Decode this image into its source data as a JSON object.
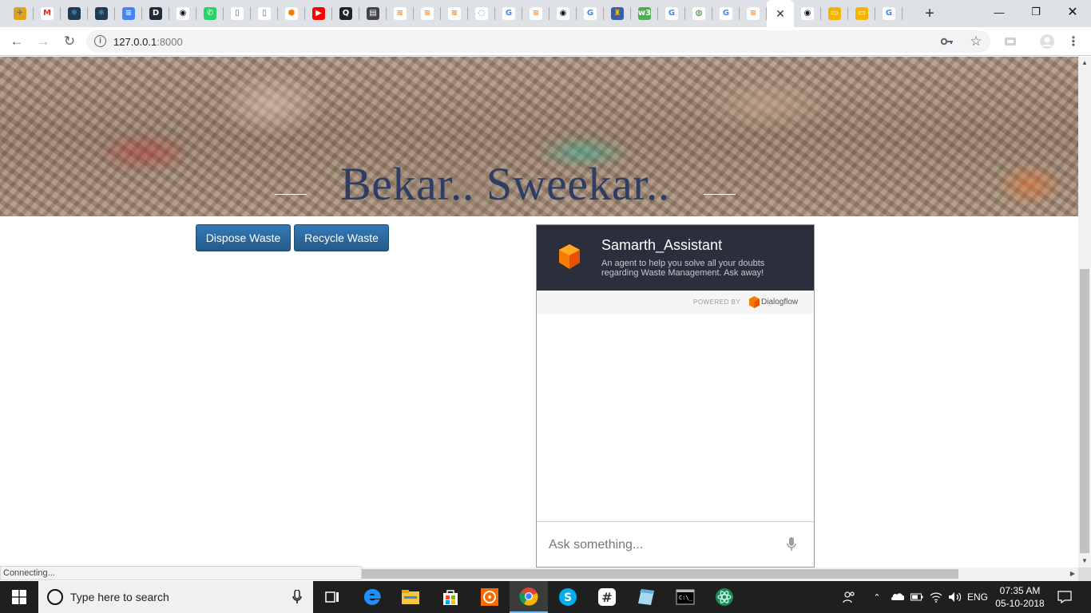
{
  "browser": {
    "tabs": [
      {
        "icon": "kite-icon",
        "glyph": "✈",
        "color": "#e0a020",
        "text_color": "#3b6fb0"
      },
      {
        "icon": "gmail-icon",
        "glyph": "M",
        "color": "#ffffff",
        "text_color": "#d93025"
      },
      {
        "icon": "react-icon",
        "glyph": "⚛",
        "color": "#1f3a52",
        "text_color": "#61dafb"
      },
      {
        "icon": "react-icon",
        "glyph": "⚛",
        "color": "#1f3a52",
        "text_color": "#61dafb"
      },
      {
        "icon": "google-docs-icon",
        "glyph": "≡",
        "color": "#4285f4",
        "text_color": "#ffffff"
      },
      {
        "icon": "dev-icon",
        "glyph": "D",
        "color": "#1d2b3a",
        "text_color": "#ffffff"
      },
      {
        "icon": "github-icon",
        "glyph": "◉",
        "color": "#ffffff",
        "text_color": "#111111"
      },
      {
        "icon": "whatsapp-icon",
        "glyph": "✆",
        "color": "#25d366",
        "text_color": "#ffffff"
      },
      {
        "icon": "document-icon",
        "glyph": "▯",
        "color": "#ffffff",
        "text_color": "#666666"
      },
      {
        "icon": "document-icon",
        "glyph": "▯",
        "color": "#ffffff",
        "text_color": "#666666"
      },
      {
        "icon": "dialogflow-icon",
        "glyph": "⬢",
        "color": "#ffffff",
        "text_color": "#f57c00"
      },
      {
        "icon": "youtube-icon",
        "glyph": "▶",
        "color": "#ff0000",
        "text_color": "#ffffff"
      },
      {
        "icon": "quora-icon",
        "glyph": "Q",
        "color": "#222222",
        "text_color": "#ffffff"
      },
      {
        "icon": "reader-icon",
        "glyph": "▤",
        "color": "#444444",
        "text_color": "#ffffff"
      },
      {
        "icon": "stackoverflow-icon",
        "glyph": "≋",
        "color": "#ffffff",
        "text_color": "#f48024"
      },
      {
        "icon": "stackoverflow-icon",
        "glyph": "≋",
        "color": "#ffffff",
        "text_color": "#f48024"
      },
      {
        "icon": "stackoverflow-icon",
        "glyph": "≋",
        "color": "#ffffff",
        "text_color": "#f48024"
      },
      {
        "icon": "loading-icon",
        "glyph": "◌",
        "color": "#ffffff",
        "text_color": "#4285f4"
      },
      {
        "icon": "google-icon",
        "glyph": "G",
        "color": "#ffffff",
        "text_color": "#4285f4"
      },
      {
        "icon": "stackoverflow-icon",
        "glyph": "≋",
        "color": "#ffffff",
        "text_color": "#f48024"
      },
      {
        "icon": "github-icon",
        "glyph": "◉",
        "color": "#ffffff",
        "text_color": "#111111"
      },
      {
        "icon": "google-icon",
        "glyph": "G",
        "color": "#ffffff",
        "text_color": "#4285f4"
      },
      {
        "icon": "lamp-icon",
        "glyph": "♜",
        "color": "#3a5fa8",
        "text_color": "#f2c200"
      },
      {
        "icon": "w3schools-icon",
        "glyph": "w3",
        "color": "#4caf50",
        "text_color": "#ffffff"
      },
      {
        "icon": "google-icon",
        "glyph": "G",
        "color": "#ffffff",
        "text_color": "#4285f4"
      },
      {
        "icon": "globe-icon",
        "glyph": "◍",
        "color": "#ffffff",
        "text_color": "#2e7d32"
      },
      {
        "icon": "google-icon",
        "glyph": "G",
        "color": "#ffffff",
        "text_color": "#4285f4"
      },
      {
        "icon": "stackoverflow-icon",
        "glyph": "≋",
        "color": "#ffffff",
        "text_color": "#f48024"
      },
      {
        "icon": "close-icon",
        "glyph": "✕",
        "active": true
      },
      {
        "icon": "github-icon",
        "glyph": "◉",
        "color": "#ffffff",
        "text_color": "#111111"
      },
      {
        "icon": "google-slides-icon",
        "glyph": "▭",
        "color": "#f4b400",
        "text_color": "#ffffff"
      },
      {
        "icon": "google-slides-icon",
        "glyph": "▭",
        "color": "#f4b400",
        "text_color": "#ffffff"
      },
      {
        "icon": "google-icon",
        "glyph": "G",
        "color": "#ffffff",
        "text_color": "#4285f4"
      }
    ],
    "url_host": "127.0.0.1",
    "url_port": ":8000"
  },
  "page": {
    "hero_title": "Bekar.. Sweekar..",
    "dispose_label": "Dispose Waste",
    "recycle_label": "Recycle Waste",
    "status_text": "Connecting..."
  },
  "agent": {
    "name": "Samarth_Assistant",
    "description": "An agent to help you solve all your doubts regarding Waste Management. Ask away!",
    "powered_by": "POWERED BY",
    "brand": "Dialogflow",
    "input_placeholder": "Ask something..."
  },
  "taskbar": {
    "search_placeholder": "Type here to search",
    "language": "ENG",
    "time": "07:35 AM",
    "date": "05-10-2018"
  }
}
